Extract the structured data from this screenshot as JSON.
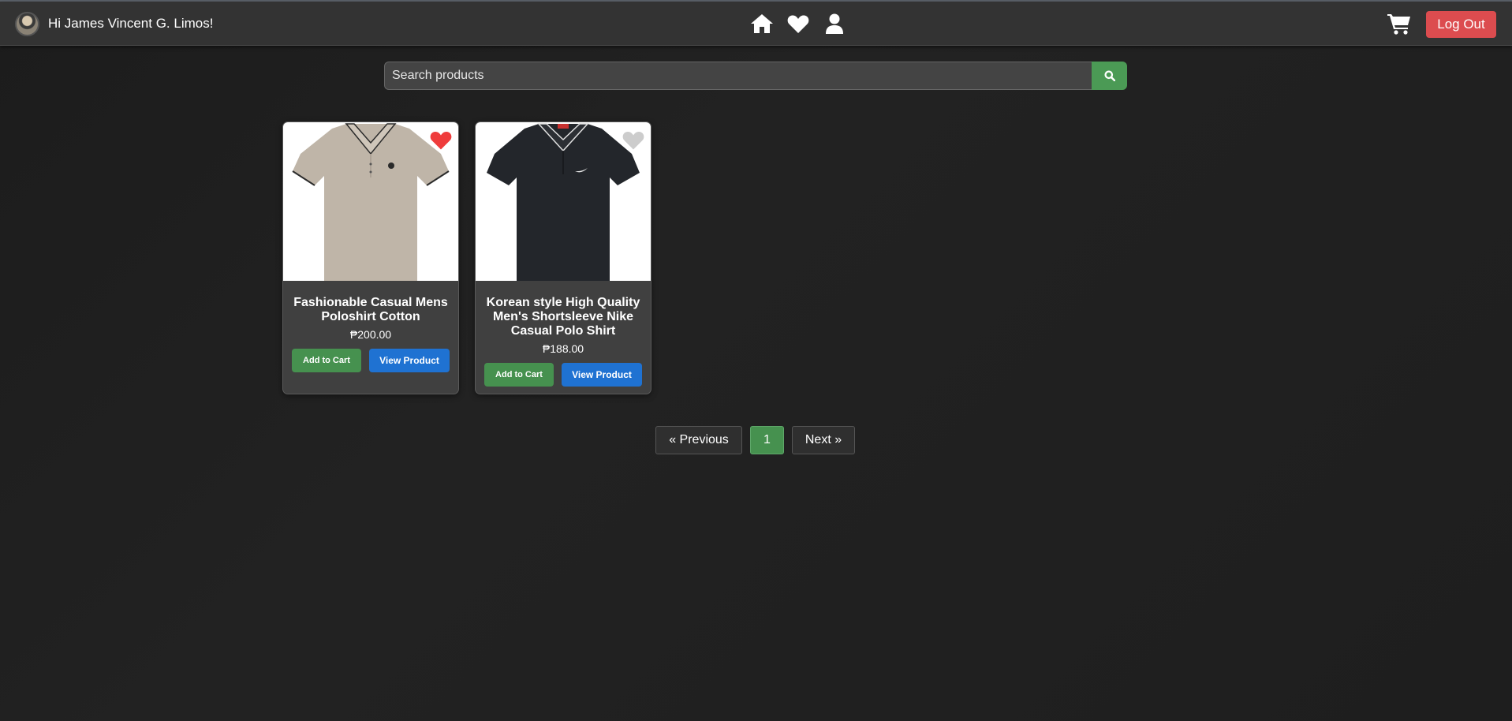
{
  "header": {
    "greeting": "Hi James Vincent G. Limos!",
    "logout_label": "Log Out",
    "nav_icons": [
      "home-icon",
      "heart-icon",
      "user-icon"
    ],
    "cart_icon": "cart-icon"
  },
  "search": {
    "placeholder": "Search products",
    "value": "",
    "button_icon": "search-icon"
  },
  "products": [
    {
      "title": "Fashionable Casual Mens Poloshirt Cotton",
      "price": "₱200.00",
      "favorited": true,
      "add_to_cart_label": "Add to Cart",
      "view_label": "View Product"
    },
    {
      "title": "Korean style High Quality Men's Shortsleeve Nike Casual Polo Shirt",
      "price": "₱188.00",
      "favorited": false,
      "add_to_cart_label": "Add to Cart",
      "view_label": "View Product"
    }
  ],
  "pagination": {
    "previous_label": "« Previous",
    "current_page": "1",
    "next_label": "Next »"
  },
  "colors": {
    "background": "#222222",
    "navbar": "#333333",
    "accent_green": "#46914f",
    "accent_blue": "#1f72d2",
    "logout_red": "#dc4c4f",
    "favorite_red": "#ef3c3c",
    "favorite_off": "#cccccc"
  }
}
